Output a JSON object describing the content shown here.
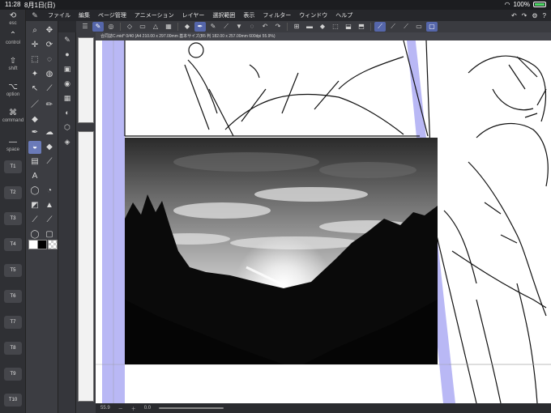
{
  "status": {
    "time": "11:28",
    "date": "8月1日(日)",
    "battery": "100%"
  },
  "menu": {
    "items": [
      "ファイル",
      "編集",
      "ページ管理",
      "アニメーション",
      "レイヤー",
      "選択範囲",
      "表示",
      "フィルター",
      "ウィンドウ",
      "ヘルプ"
    ]
  },
  "keys": {
    "esc": "esc",
    "control": "control",
    "shift": "shift",
    "option": "option",
    "command": "command",
    "space": "space",
    "tkeys": [
      "T1",
      "T2",
      "T3",
      "T4",
      "T5",
      "T6",
      "T7",
      "T8",
      "T9",
      "T10"
    ]
  },
  "document": {
    "tab_title": "合同誌C.mid* 0/40 (A4 210.00 x 297.00mm 基本サイズ(B5 判 182.00 x 257.00mm 600dpi 55.9%)"
  },
  "bottombar": {
    "zoom": "55.9",
    "rotation": "0.0"
  },
  "colors": {
    "accent": "#5566aa",
    "bleed": "#b9b8f5",
    "ui_dark": "#2b2c30"
  }
}
